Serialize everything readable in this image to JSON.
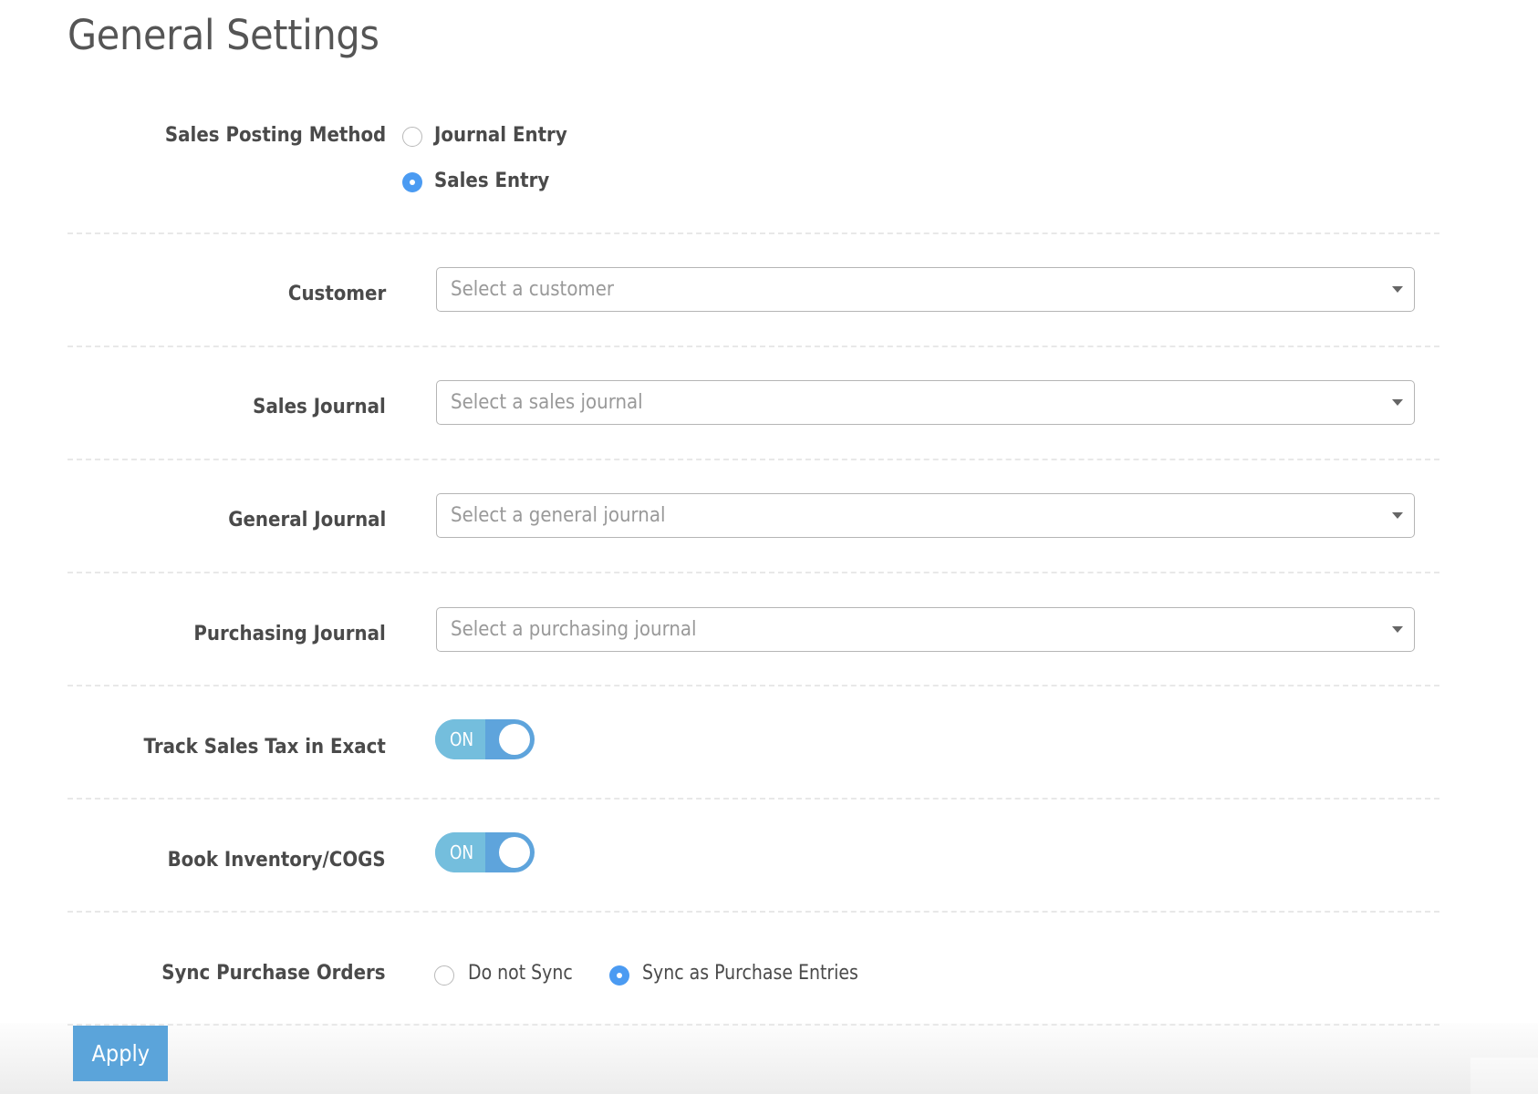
{
  "page": {
    "title": "General Settings"
  },
  "colors": {
    "accent": "#4b9bf2",
    "toggle_on": "#74bedd",
    "toggle_track": "#5ea4dc",
    "apply_button": "#5ba4da"
  },
  "sales_posting_method": {
    "label": "Sales Posting Method",
    "options": [
      {
        "label": "Journal Entry",
        "checked": false
      },
      {
        "label": "Sales Entry",
        "checked": true
      }
    ]
  },
  "customer": {
    "label": "Customer",
    "placeholder": "Select a customer",
    "value": ""
  },
  "sales_journal": {
    "label": "Sales Journal",
    "placeholder": "Select a sales journal",
    "value": ""
  },
  "general_journal": {
    "label": "General Journal",
    "placeholder": "Select a general journal",
    "value": ""
  },
  "purchasing_journal": {
    "label": "Purchasing Journal",
    "placeholder": "Select a purchasing journal",
    "value": ""
  },
  "track_sales_tax": {
    "label": "Track Sales Tax in Exact",
    "state": "ON",
    "enabled": true
  },
  "book_inventory": {
    "label": "Book Inventory/COGS",
    "state": "ON",
    "enabled": true
  },
  "sync_purchase_orders": {
    "label": "Sync Purchase Orders",
    "options": [
      {
        "label": "Do not Sync",
        "checked": false
      },
      {
        "label": "Sync as Purchase Entries",
        "checked": true
      }
    ]
  },
  "actions": {
    "apply_label": "Apply"
  }
}
